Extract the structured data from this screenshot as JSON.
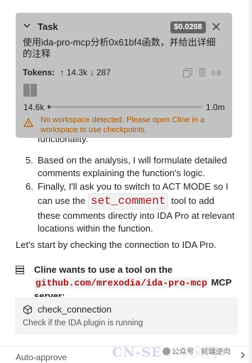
{
  "task": {
    "title": "Task",
    "cost": "$0.0208",
    "description": "使用ida-pro-mcp分析0x61bf4函数，并给出详细的注释",
    "tokens_label": "Tokens:",
    "tokens_up": "14.3k",
    "tokens_down": "287",
    "storage_size": "0 B",
    "context_used": "14.6k",
    "context_max": "1.0m",
    "context_fraction": 0.015,
    "warning": "No workspace detected. Please open Cline in a workspace to use checkpoints."
  },
  "plan": {
    "partial_text": "functionality.",
    "steps": [
      {
        "num": "5.",
        "text": "Based on the analysis, I will formulate detailed comments explaining the function's logic."
      },
      {
        "num": "6.",
        "text_before": "Finally, I'll ask you to switch to ACT MODE so I can use the",
        "code": "set_comment",
        "text_after": "tool to add these comments directly into IDA Pro at relevant locations within the function."
      }
    ]
  },
  "message": "Let's start by checking the connection to IDA Pro.",
  "tool_request": {
    "prefix": "Cline wants to use a tool on the",
    "server": "github.com/mrexodia/ida-pro-mcp",
    "suffix": "MCP server:",
    "tool_name": "check_connection",
    "tool_description": "Check if the IDA plugin is running"
  },
  "footer": {
    "auto_approve": "Auto-approve"
  },
  "watermark": {
    "brand": "CN-SEC 中文网",
    "account": "公众号 · 前端逆向"
  },
  "colors": {
    "task_card_bg": "#c2c2c2",
    "code_red": "#a3151a",
    "warning": "#b05a00"
  }
}
